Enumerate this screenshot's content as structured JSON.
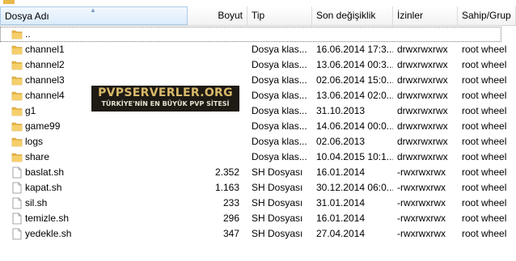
{
  "columns": {
    "name": "Dosya Adı",
    "size": "Boyut",
    "type": "Tip",
    "date": "Son değişiklik",
    "perms": "İzinler",
    "owner": "Sahip/Grup"
  },
  "sort": {
    "column": "name",
    "direction": "ascending",
    "indicator": "▲"
  },
  "files": [
    {
      "name": "..",
      "icon": "folder-icon",
      "size": "",
      "type": "",
      "date": "",
      "perms": "",
      "owner": ""
    },
    {
      "name": "channel1",
      "icon": "folder-icon",
      "size": "",
      "type": "Dosya klas...",
      "date": "16.06.2014 17:3...",
      "perms": "drwxrwxrwx",
      "owner": "root wheel"
    },
    {
      "name": "channel2",
      "icon": "folder-icon",
      "size": "",
      "type": "Dosya klas...",
      "date": "13.06.2014 00:3...",
      "perms": "drwxrwxrwx",
      "owner": "root wheel"
    },
    {
      "name": "channel3",
      "icon": "folder-icon",
      "size": "",
      "type": "Dosya klas...",
      "date": "02.06.2014 15:0...",
      "perms": "drwxrwxrwx",
      "owner": "root wheel"
    },
    {
      "name": "channel4",
      "icon": "folder-icon",
      "size": "",
      "type": "Dosya klas...",
      "date": "13.06.2014 02:0...",
      "perms": "drwxrwxrwx",
      "owner": "root wheel"
    },
    {
      "name": "g1",
      "icon": "folder-icon",
      "size": "",
      "type": "Dosya klas...",
      "date": "31.10.2013",
      "perms": "drwxrwxrwx",
      "owner": "root wheel"
    },
    {
      "name": "game99",
      "icon": "folder-icon",
      "size": "",
      "type": "Dosya klas...",
      "date": "14.06.2014 00:0...",
      "perms": "drwxrwxrwx",
      "owner": "root wheel"
    },
    {
      "name": "logs",
      "icon": "folder-icon",
      "size": "",
      "type": "Dosya klas...",
      "date": "02.06.2013",
      "perms": "drwxrwxrwx",
      "owner": "root wheel"
    },
    {
      "name": "share",
      "icon": "folder-icon",
      "size": "",
      "type": "Dosya klas...",
      "date": "10.04.2015 10:1...",
      "perms": "drwxrwxrwx",
      "owner": "root wheel"
    },
    {
      "name": "baslat.sh",
      "icon": "file-icon",
      "size": "2.352",
      "type": "SH Dosyası",
      "date": "16.01.2014",
      "perms": "-rwxrwxrwx",
      "owner": "root wheel"
    },
    {
      "name": "kapat.sh",
      "icon": "file-icon",
      "size": "1.163",
      "type": "SH Dosyası",
      "date": "30.12.2014 06:0...",
      "perms": "-rwxrwxrwx",
      "owner": "root wheel"
    },
    {
      "name": "sil.sh",
      "icon": "file-icon",
      "size": "233",
      "type": "SH Dosyası",
      "date": "31.01.2014",
      "perms": "-rwxrwxrwx",
      "owner": "root wheel"
    },
    {
      "name": "temizle.sh",
      "icon": "file-icon",
      "size": "296",
      "type": "SH Dosyası",
      "date": "16.01.2014",
      "perms": "-rwxrwxrwx",
      "owner": "root wheel"
    },
    {
      "name": "yedekle.sh",
      "icon": "file-icon",
      "size": "347",
      "type": "SH Dosyası",
      "date": "27.04.2014",
      "perms": "-rwxrwxrwx",
      "owner": "root wheel"
    }
  ],
  "watermark": {
    "line1": "PVPSERVERLER.ORG",
    "line2": "TÜRKİYE'NİN EN BÜYÜK PVP SİTESİ"
  },
  "colors": {
    "folder": "#e8b84a",
    "sorted_header": "#dcecfb",
    "banner_bg": "#1e1a14",
    "banner_gold": "#d8b86a"
  }
}
